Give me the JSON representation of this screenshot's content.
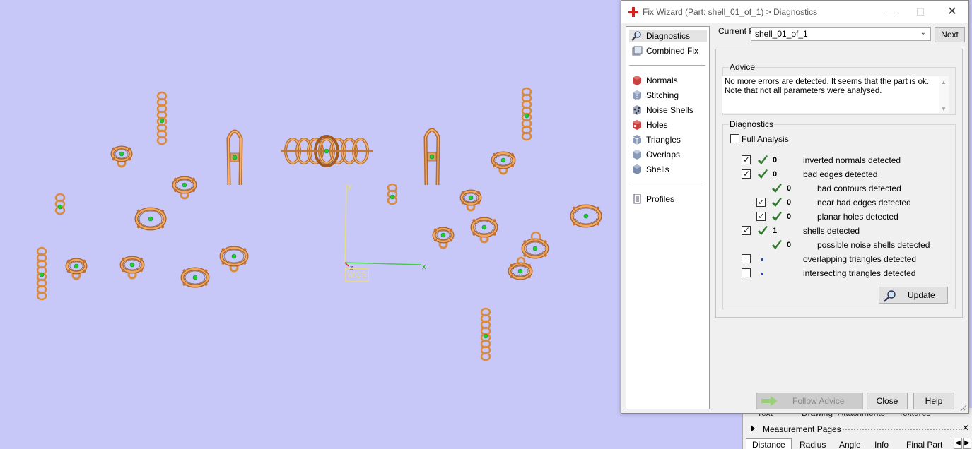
{
  "dialog": {
    "title": "Fix Wizard (Part: shell_01_of_1) > Diagnostics",
    "current_part_label": "Current Part:",
    "current_part_value": "shell_01_of_1",
    "next_label": "Next",
    "nav": {
      "items_top": [
        {
          "label": "Diagnostics",
          "icon": "magnifier-icon",
          "selected": true
        },
        {
          "label": "Combined Fix",
          "icon": "combined-fix-icon"
        }
      ],
      "items_mid": [
        {
          "label": "Normals",
          "icon": "normals-icon"
        },
        {
          "label": "Stitching",
          "icon": "stitching-icon"
        },
        {
          "label": "Noise Shells",
          "icon": "noise-shells-icon"
        },
        {
          "label": "Holes",
          "icon": "holes-icon"
        },
        {
          "label": "Triangles",
          "icon": "triangles-icon"
        },
        {
          "label": "Overlaps",
          "icon": "overlaps-icon"
        },
        {
          "label": "Shells",
          "icon": "shells-icon"
        }
      ],
      "items_bottom": [
        {
          "label": "Profiles",
          "icon": "profiles-icon"
        }
      ]
    },
    "advice": {
      "title": "Advice",
      "line1": "No more errors are detected. It seems that the part is ok.",
      "line2": "Note that not all parameters were analysed."
    },
    "diagnostics": {
      "title": "Diagnostics",
      "full_analysis_label": "Full Analysis",
      "rows": [
        {
          "checked": true,
          "status": "ok",
          "count": "0",
          "label": "inverted normals detected"
        },
        {
          "checked": true,
          "status": "ok",
          "count": "0",
          "label": "bad edges detected"
        },
        {
          "checked": null,
          "status": "ok",
          "count": "0",
          "label": "bad contours detected"
        },
        {
          "checked": true,
          "status": "ok",
          "count": "0",
          "label": "near bad edges detected"
        },
        {
          "checked": true,
          "status": "ok",
          "count": "0",
          "label": "planar holes detected"
        },
        {
          "checked": true,
          "status": "ok",
          "count": "1",
          "label": "shells detected"
        },
        {
          "checked": null,
          "status": "ok",
          "count": "0",
          "label": "possible noise shells detected"
        },
        {
          "checked": false,
          "status": "not-analysed",
          "count": "",
          "label": "overlapping triangles detected"
        },
        {
          "checked": false,
          "status": "not-analysed",
          "count": "",
          "label": "intersecting triangles detected"
        }
      ],
      "update_label": "Update"
    },
    "buttons": {
      "follow_advice": "Follow Advice",
      "close": "Close",
      "help": "Help"
    }
  },
  "viewport": {
    "axis_labels": {
      "y": "y",
      "x": "x",
      "z": "z"
    },
    "wcs_label": "WCS",
    "colors": {
      "background": "#c8c8f8",
      "part": "#d98a3c",
      "marker": "#22cc22"
    }
  },
  "under_panel": {
    "top_tabs": [
      "Text",
      "Drawing",
      "Attachments",
      "Textures"
    ],
    "measurement_pages": "Measurement Pages",
    "tabs": [
      "Distance",
      "Radius",
      "Angle",
      "Info",
      "Final Part"
    ]
  }
}
